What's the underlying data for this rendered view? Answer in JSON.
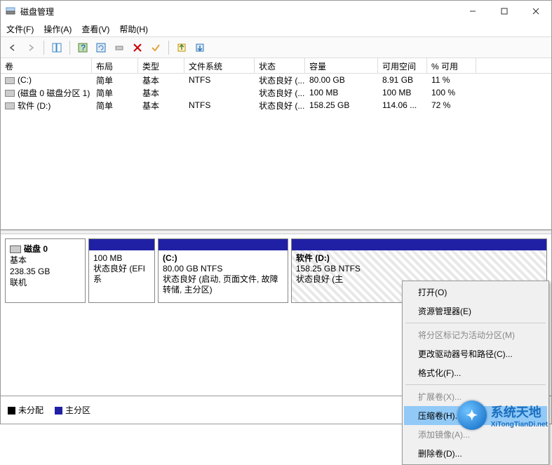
{
  "window": {
    "title": "磁盘管理"
  },
  "menu": {
    "file": "文件(F)",
    "action": "操作(A)",
    "view": "查看(V)",
    "help": "帮助(H)"
  },
  "columns": {
    "volume": "卷",
    "layout": "布局",
    "type": "类型",
    "fs": "文件系统",
    "status": "状态",
    "capacity": "容量",
    "free": "可用空间",
    "pct": "% 可用"
  },
  "volumes": [
    {
      "name": "(C:)",
      "layout": "简单",
      "type": "基本",
      "fs": "NTFS",
      "status": "状态良好 (...",
      "capacity": "80.00 GB",
      "free": "8.91 GB",
      "pct": "11 %"
    },
    {
      "name": "(磁盘 0 磁盘分区 1)",
      "layout": "简单",
      "type": "基本",
      "fs": "",
      "status": "状态良好 (...",
      "capacity": "100 MB",
      "free": "100 MB",
      "pct": "100 %"
    },
    {
      "name": "软件 (D:)",
      "layout": "简单",
      "type": "基本",
      "fs": "NTFS",
      "status": "状态良好 (...",
      "capacity": "158.25 GB",
      "free": "114.06 ...",
      "pct": "72 %"
    }
  ],
  "disk": {
    "name": "磁盘 0",
    "type": "基本",
    "size": "238.35 GB",
    "status": "联机"
  },
  "partitions": {
    "p0": {
      "size": "100 MB",
      "status": "状态良好 (EFI 系"
    },
    "p1": {
      "name": "(C:)",
      "size_fs": "80.00 GB NTFS",
      "status": "状态良好 (启动, 页面文件, 故障转储, 主分区)"
    },
    "p2": {
      "name": "软件  (D:)",
      "size_fs": "158.25 GB NTFS",
      "status": "状态良好 (主"
    }
  },
  "legend": {
    "unalloc": "未分配",
    "primary": "主分区"
  },
  "context": {
    "open": "打开(O)",
    "explorer": "资源管理器(E)",
    "mark_active": "将分区标记为活动分区(M)",
    "change_letter": "更改驱动器号和路径(C)...",
    "format": "格式化(F)...",
    "extend": "扩展卷(X)...",
    "shrink": "压缩卷(H)...",
    "add_mirror": "添加镜像(A)...",
    "delete": "删除卷(D)..."
  },
  "watermark": {
    "cn": "系统天地",
    "en": "XiTongTianDi.net"
  }
}
